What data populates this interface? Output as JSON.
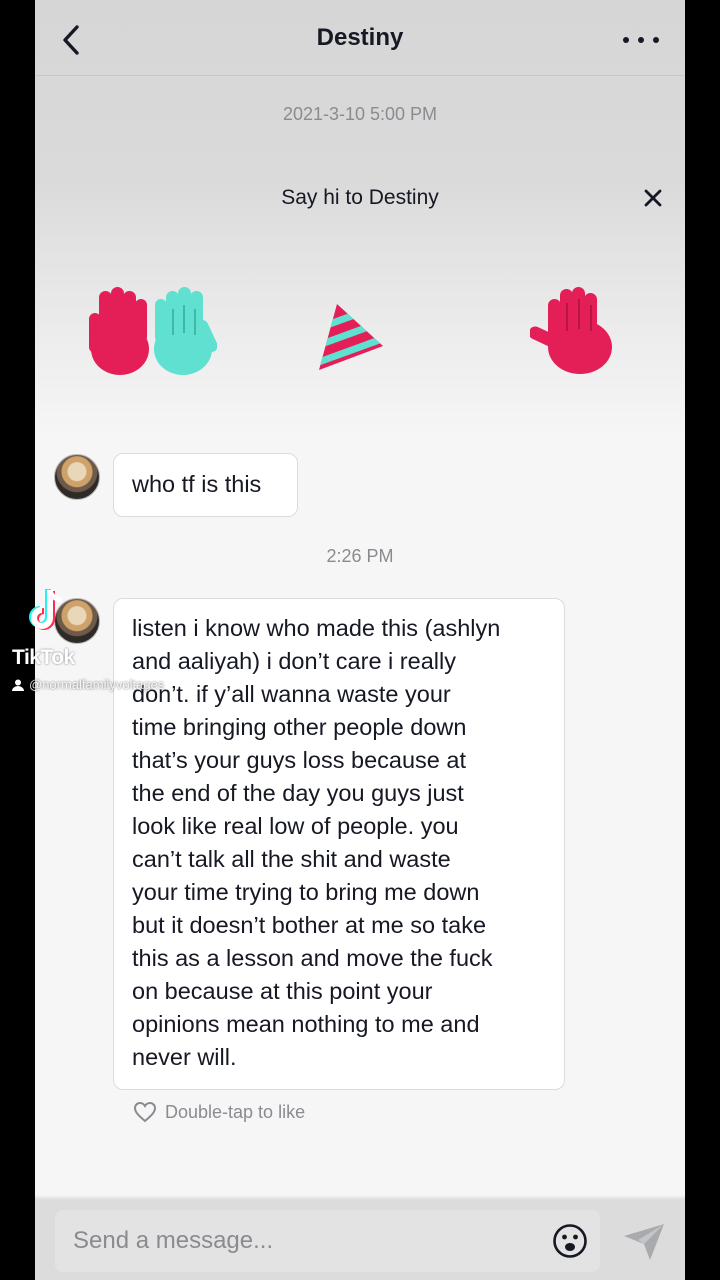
{
  "header": {
    "title": "Destiny"
  },
  "conversation": {
    "start_timestamp": "2021-3-10 5:00 PM",
    "say_hi": "Say hi to Destiny",
    "messages": [
      {
        "text": "who tf is this"
      },
      {
        "lines": [
          "listen i know who made this (ashlyn",
          "and aaliyah) i don’t care i really",
          "don’t. if y’all wanna waste your",
          "time bringing other people down",
          "that’s your guys loss because at",
          "the end of the day you guys just",
          "look like real low of people. you",
          "can’t talk all the shit and waste",
          "your time trying to bring me down",
          "but it doesn’t bother at me so take",
          "this as a lesson and move the fuck",
          "on because at this point your",
          "opinions mean nothing to me and",
          "never will."
        ]
      }
    ],
    "second_timestamp": "2:26 PM",
    "like_hint": "Double-tap to like"
  },
  "composer": {
    "placeholder": "Send a message..."
  },
  "watermark": {
    "brand": "TikTok",
    "username": "@normalfamilyvoltages"
  },
  "colors": {
    "sticker_red": "#e41e57",
    "sticker_teal": "#5fe0d0",
    "background": "#f6f6f6",
    "text": "#161823",
    "muted": "#8a8b91"
  },
  "icons": [
    "back-arrow-icon",
    "more-dots-icon",
    "close-icon",
    "heart-icon",
    "emoji-icon",
    "send-icon",
    "tiktok-logo-icon",
    "user-icon"
  ]
}
